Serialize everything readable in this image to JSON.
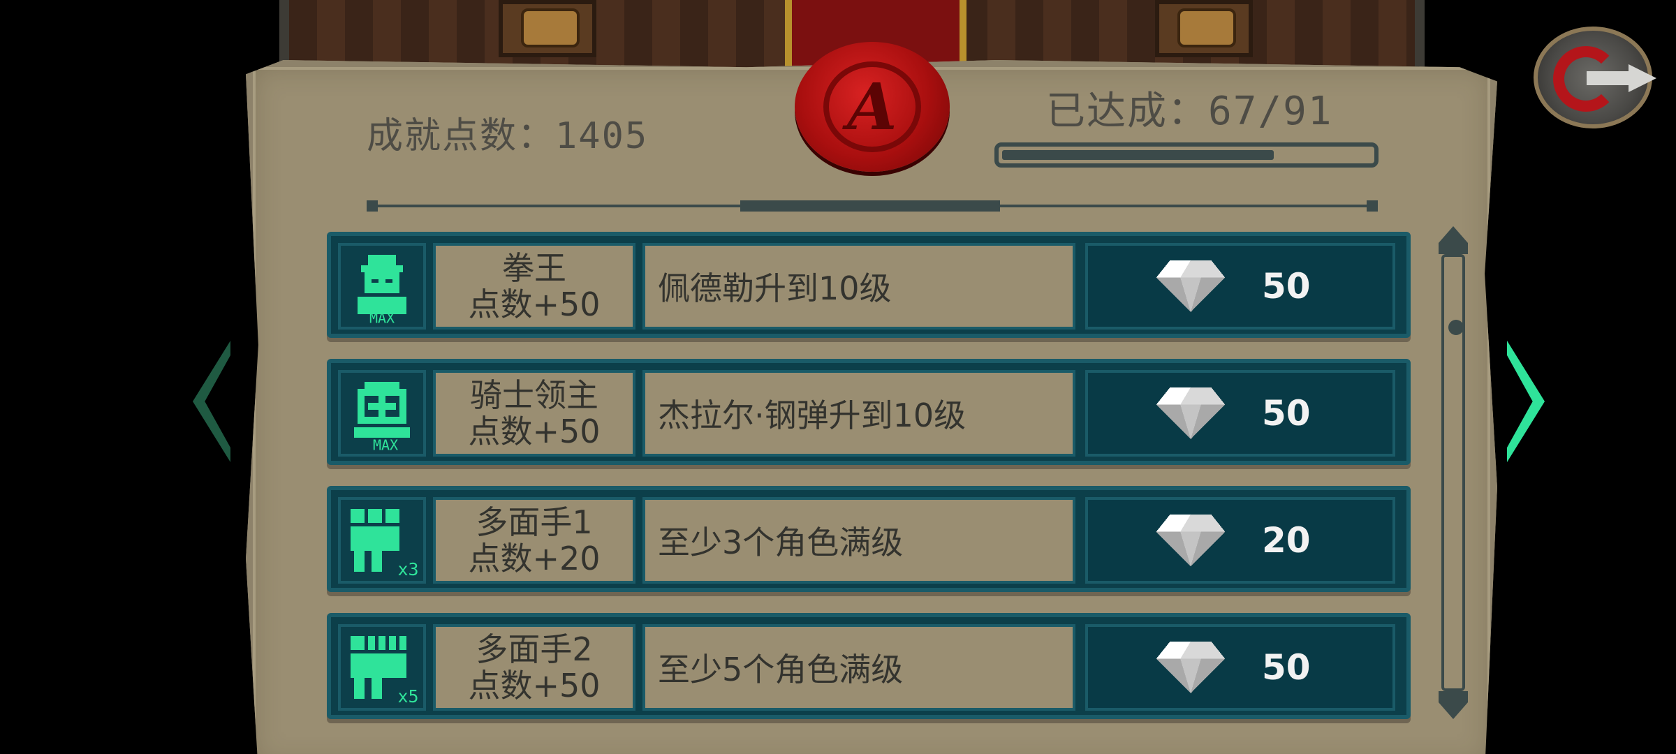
{
  "header": {
    "points_text": "成就点数：1405",
    "achieved_text": "已达成：67/91",
    "achieved_count": 67,
    "achieved_total": 91,
    "progress_fraction": 0.736
  },
  "seal": {
    "letter": "A"
  },
  "achievements": [
    {
      "icon": "bandana-max-icon",
      "title": "拳王",
      "points_text": "点数+50",
      "description": "佩德勒升到10级",
      "reward": "50"
    },
    {
      "icon": "knight-max-icon",
      "title": "骑士领主",
      "points_text": "点数+50",
      "description": "杰拉尔·钢弹升到10级",
      "reward": "50"
    },
    {
      "icon": "group-x3-icon",
      "title": "多面手1",
      "points_text": "点数+20",
      "description": "至少3个角色满级",
      "reward": "20"
    },
    {
      "icon": "group-x5-icon",
      "title": "多面手2",
      "points_text": "点数+50",
      "description": "至少5个角色满级",
      "reward": "50"
    }
  ],
  "colors": {
    "parchment": "#9a8e72",
    "row_bg": "#0c3f4a",
    "accent_green": "#2fe39a",
    "seal_red": "#b4151a"
  }
}
